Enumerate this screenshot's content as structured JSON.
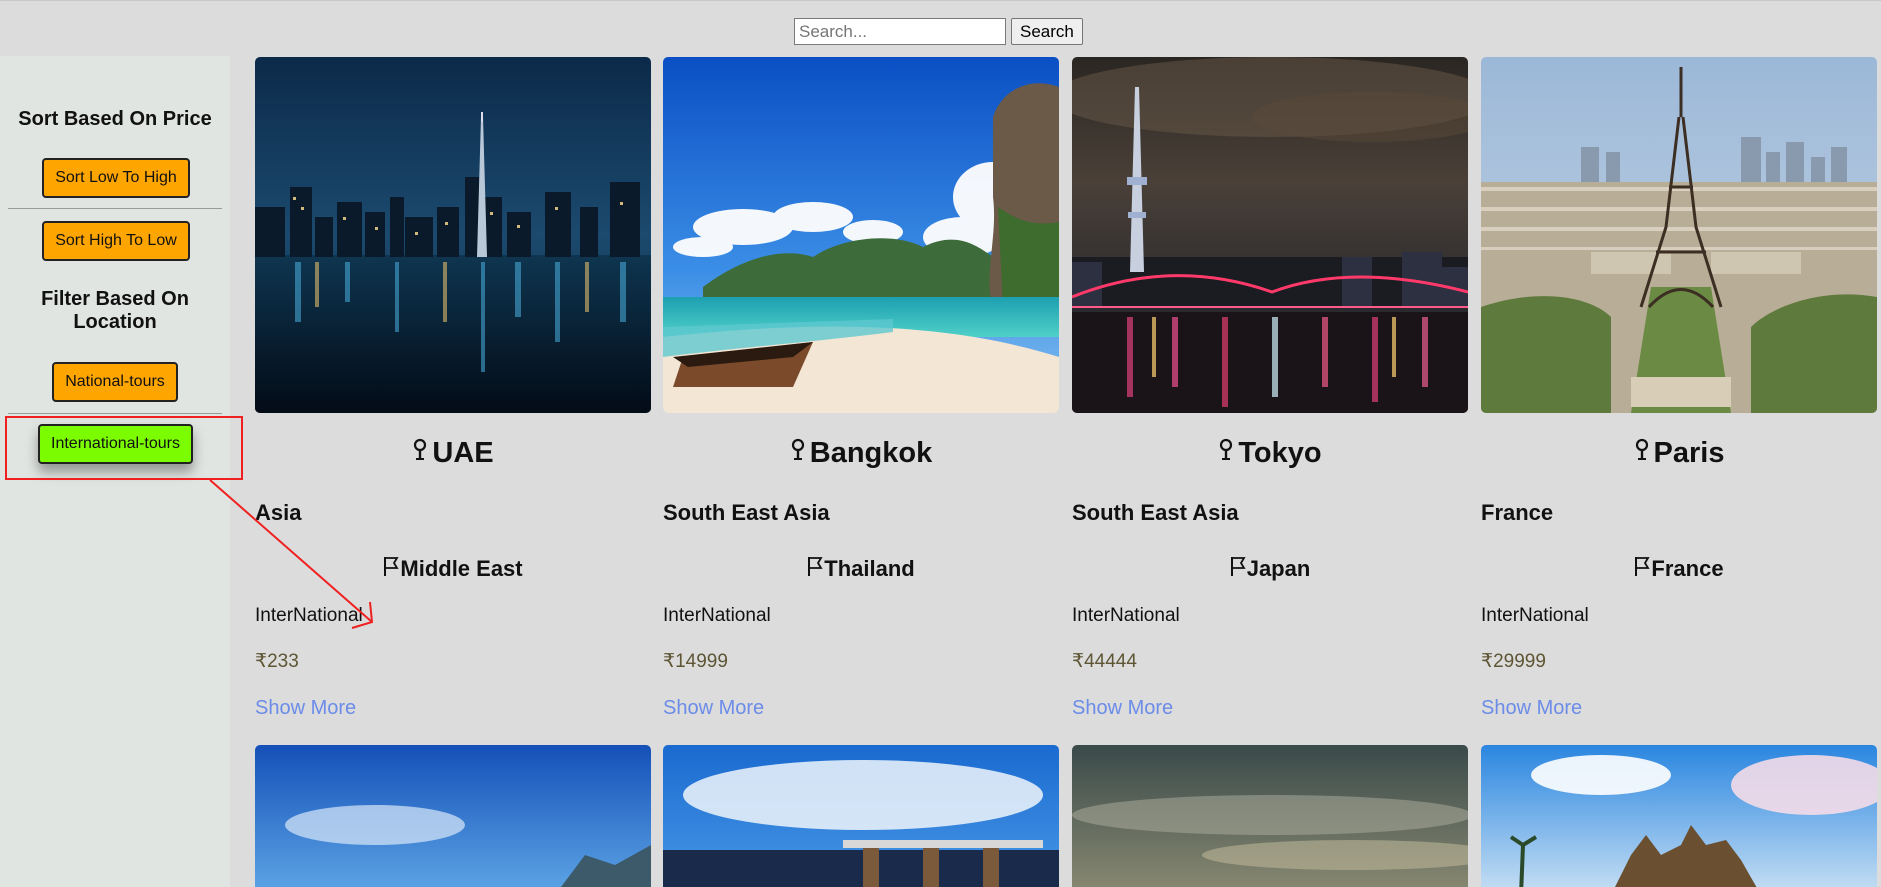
{
  "search": {
    "placeholder": "Search...",
    "button_label": "Search"
  },
  "sidebar": {
    "sort_heading": "Sort Based On Price",
    "sort_low_label": "Sort Low To High",
    "sort_high_label": "Sort High To Low",
    "filter_heading": "Filter Based On Location",
    "national_label": "National-tours",
    "international_label": "International-tours"
  },
  "cards": [
    {
      "city": "UAE",
      "region": "Asia",
      "country": "Middle East",
      "type": "InterNational",
      "price": "₹233",
      "show_more": "Show More"
    },
    {
      "city": "Bangkok",
      "region": "South East Asia",
      "country": "Thailand",
      "type": "InterNational",
      "price": "₹14999",
      "show_more": "Show More"
    },
    {
      "city": "Tokyo",
      "region": "South East Asia",
      "country": "Japan",
      "type": "InterNational",
      "price": "₹44444",
      "show_more": "Show More"
    },
    {
      "city": "Paris",
      "region": "France",
      "country": "France",
      "type": "InterNational",
      "price": "₹29999",
      "show_more": "Show More"
    }
  ],
  "icons": {
    "location": "map-pin-icon",
    "country": "flag-icon"
  },
  "colors": {
    "button_default": "#ffa500",
    "button_active": "#7cfc00",
    "link": "#6b8ce8",
    "price": "#5e5534",
    "annotation": "#f02020"
  }
}
